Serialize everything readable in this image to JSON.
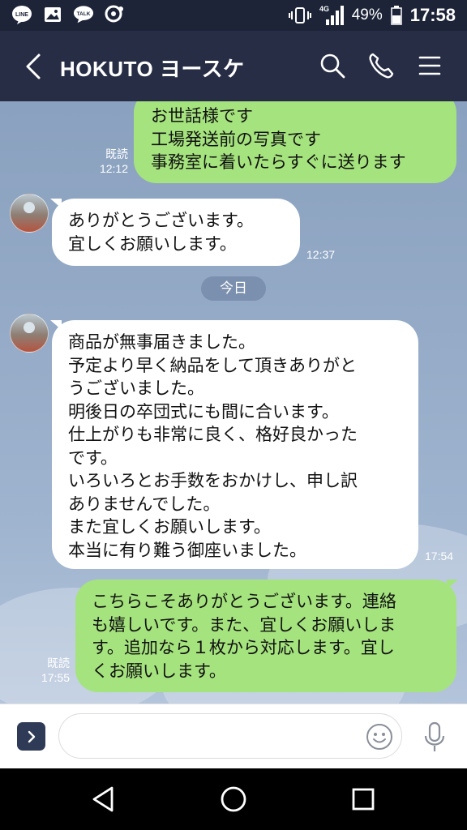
{
  "status_bar": {
    "left_icons": [
      "line-app-icon",
      "gallery-icon",
      "talk-icon",
      "messenger-icon"
    ],
    "line_label": "LINE",
    "talk_label": "TALK",
    "network": "4G",
    "battery": "49%",
    "time": "17:58"
  },
  "header": {
    "title": "HOKUTO ヨースケ",
    "icons": [
      "back-arrow-icon",
      "search-icon",
      "phone-icon",
      "menu-icon"
    ]
  },
  "messages": [
    {
      "direction": "outgoing",
      "text": "お世話様です\n工場発送前の写真です\n事務室に着いたらすぐに送ります",
      "read": "既読",
      "time": "12:12"
    },
    {
      "direction": "incoming",
      "text": "ありがとうございます。\n宜しくお願いします。",
      "time": "12:37"
    },
    {
      "direction": "incoming",
      "text": "商品が無事届きました。\n予定より早く納品をして頂きありがと\nうございました。\n明後日の卒団式にも間に合います。\n仕上がりも非常に良く、格好良かった\nです。\nいろいろとお手数をおかけし、申し訳\nありませんでした。\nまた宜しくお願いします。\n本当に有り難う御座いました。",
      "time": "17:54"
    },
    {
      "direction": "outgoing",
      "text": "こちらこそありがとうございます。連絡\nも嬉しいです。また、宜しくお願いしま\nす。追加なら１枚から対応します。宜し\nくお願いします。",
      "read": "既読",
      "time": "17:55"
    }
  ],
  "date_separator": "今日",
  "input": {
    "value": "",
    "placeholder": ""
  },
  "colors": {
    "header_bg": "#262d45",
    "outgoing_bubble": "#a5e37e",
    "incoming_bubble": "#ffffff",
    "chat_bg": "#95abc7"
  }
}
